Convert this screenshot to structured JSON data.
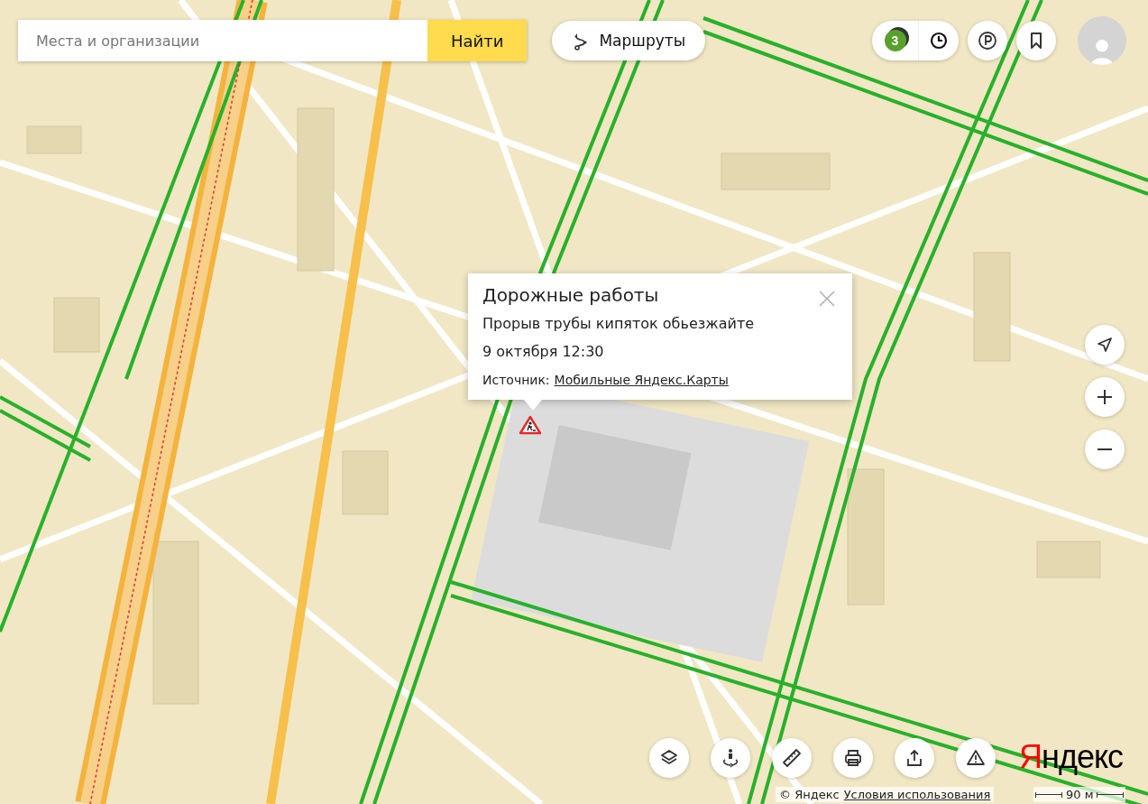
{
  "search": {
    "placeholder": "Места и организации",
    "button": "Найти"
  },
  "routes_button": "Маршруты",
  "top_controls": [
    {
      "kind": "traffic",
      "score": "3"
    },
    {
      "kind": "history"
    },
    {
      "kind": "parking"
    },
    {
      "kind": "bookmarks"
    },
    {
      "kind": "avatar"
    }
  ],
  "popup": {
    "title": "Дорожные работы",
    "description": "Прорыв трубы кипяток обьезжайте",
    "time": "9 октября 12:30",
    "source_label": "Источник:",
    "source_link": "Мобильные Яндекс.Карты"
  },
  "side_controls": [
    {
      "kind": "locate"
    },
    {
      "kind": "zoom_in"
    },
    {
      "kind": "zoom_out"
    }
  ],
  "bottom_controls": [
    {
      "kind": "layers"
    },
    {
      "kind": "panorama"
    },
    {
      "kind": "ruler"
    },
    {
      "kind": "print"
    },
    {
      "kind": "share"
    },
    {
      "kind": "report"
    }
  ],
  "logo": "Яндекс",
  "copyright": "© Яндекс",
  "terms_link": "Условия использования",
  "scale": "90 м"
}
